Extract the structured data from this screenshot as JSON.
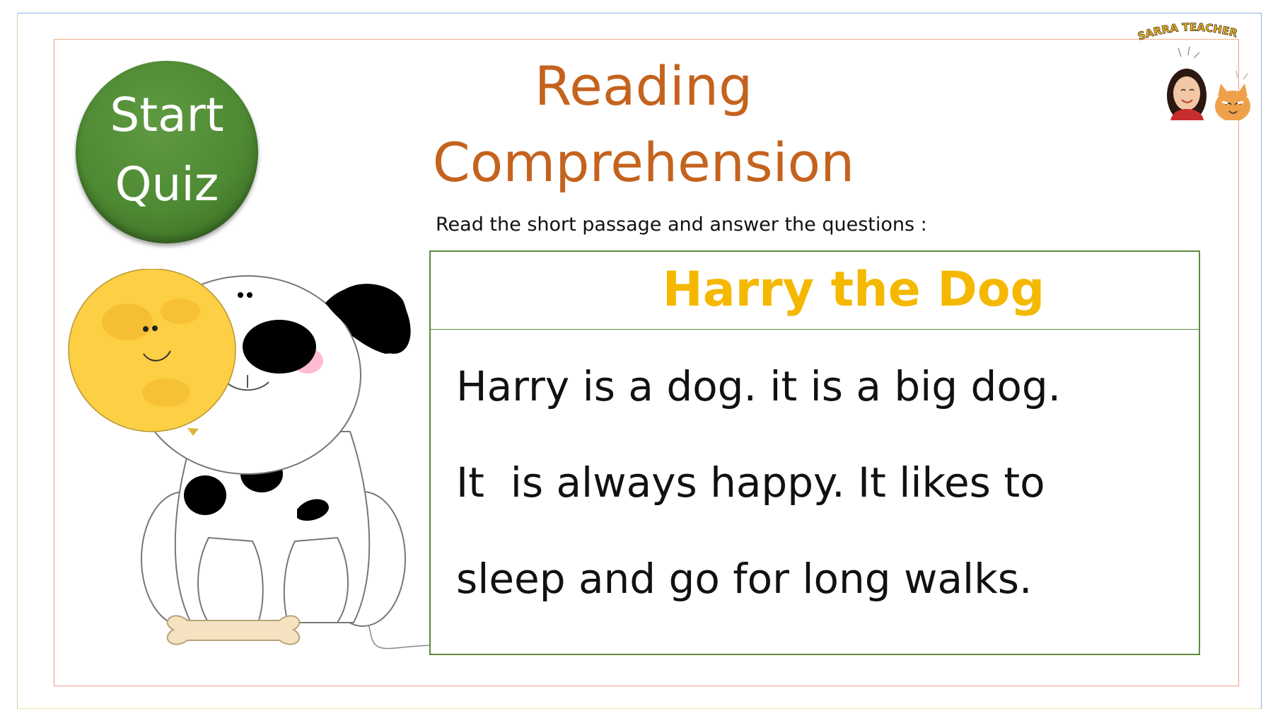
{
  "slide": {
    "title_line1": "Reading",
    "title_line2": "Comprehension",
    "instructions": "Read the short passage and answer the questions :"
  },
  "start_quiz": {
    "line1": "Start",
    "line2": "Quiz"
  },
  "story": {
    "title": "Harry the Dog",
    "lines": [
      "Harry is a dog. it is a big dog.",
      "It  is always happy. It likes to",
      "sleep and go for long walks."
    ]
  },
  "logo": {
    "text": "SARRA TEACHER"
  },
  "icons": {
    "dog": "dog-with-balloon-illustration",
    "logo": "teacher-and-cat-logo"
  },
  "colors": {
    "title": "#c4631e",
    "story_title": "#f5b800",
    "button": "#4e8a33",
    "box_border": "#5e8a3c"
  }
}
